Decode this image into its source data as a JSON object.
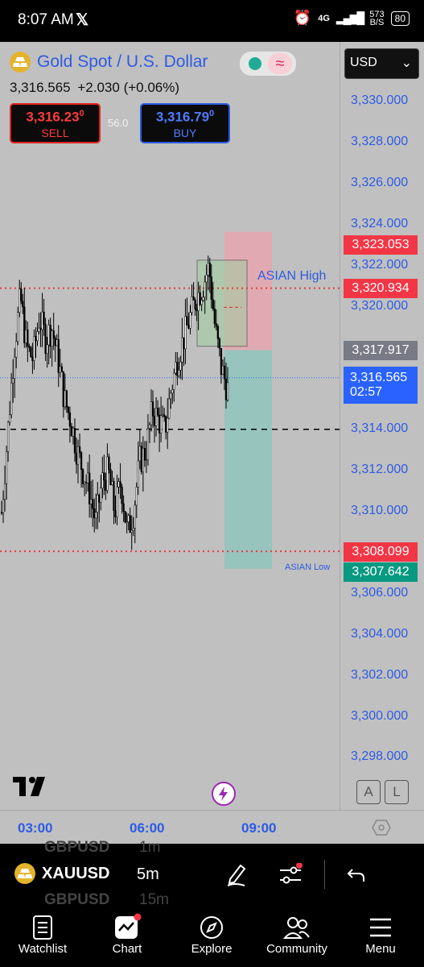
{
  "status_bar": {
    "time": "8:07 AM",
    "network": "4G",
    "speed": "573",
    "speed_unit": "B/S",
    "battery": "80"
  },
  "instrument": {
    "name": "Gold Spot / U.S. Dollar",
    "price": "3,316.565",
    "change": "+2.030 (+0.06%)"
  },
  "sell": {
    "price": "3,316.23",
    "price_sup": "0",
    "label": "SELL"
  },
  "buy": {
    "price": "3,316.79",
    "price_sup": "0",
    "label": "BUY"
  },
  "spread": "56.0",
  "currency": "USD",
  "price_axis": [
    "3,330.000",
    "3,328.000",
    "3,326.000",
    "3,324.000",
    "3,322.000",
    "3,320.000",
    "3,318.000",
    "3,316.000",
    "3,314.000",
    "3,312.000",
    "3,310.000",
    "3,308.000",
    "3,306.000",
    "3,304.000",
    "3,302.000",
    "3,300.000",
    "3,298.000"
  ],
  "price_tags": {
    "stop_loss": "3,323.053",
    "asian_high": "3,320.934",
    "entry": "3,317.917",
    "current": "3,316.565",
    "countdown": "02:57",
    "asian_low": "3,308.099",
    "take_profit": "3,307.642"
  },
  "annotations": {
    "asian_high": "ASIAN High",
    "asian_low": "ASIAN Low"
  },
  "time_axis": [
    "03:00",
    "06:00",
    "09:00"
  ],
  "scale_buttons": {
    "auto": "A",
    "log": "L"
  },
  "toolbar": {
    "symbol": "XAUUSD",
    "interval": "5m",
    "ghost_symbol_1": "GBPUSD",
    "ghost_interval_1": "1m",
    "ghost_symbol_2": "GBPUSD",
    "ghost_interval_2": "15m"
  },
  "nav": [
    {
      "label": "Watchlist",
      "icon": "watchlist-icon"
    },
    {
      "label": "Chart",
      "icon": "chart-icon"
    },
    {
      "label": "Explore",
      "icon": "compass-icon"
    },
    {
      "label": "Community",
      "icon": "community-icon"
    },
    {
      "label": "Menu",
      "icon": "menu-icon"
    }
  ],
  "colors": {
    "accent_blue": "#2d5be3",
    "sell_red": "#e02424",
    "tp_green": "#1f9e7d",
    "sl_pink": "#e8a4ae",
    "tp_fill": "#8fc4bb"
  },
  "chart_data": {
    "type": "candlestick",
    "symbol": "XAUUSD",
    "interval": "5m",
    "ylim": [
      3297,
      3331
    ],
    "trade": {
      "direction": "short",
      "entry": 3317.917,
      "stop_loss": 3323.053,
      "take_profit": 3307.642
    },
    "levels": [
      {
        "label": "ASIAN High",
        "value": 3320.934
      },
      {
        "label": "ASIAN Low",
        "value": 3308.099
      }
    ],
    "last_price": 3316.565,
    "close_path": [
      3310,
      3314,
      3318,
      3320.5,
      3318,
      3317.5,
      3319.5,
      3318.5,
      3319,
      3317.5,
      3315.5,
      3314.5,
      3313,
      3312,
      3311,
      3309.5,
      3311.5,
      3312,
      3310,
      3311.5,
      3309,
      3310,
      3312.5,
      3313,
      3315,
      3314.5,
      3314,
      3316,
      3317.5,
      3318.5,
      3319.5,
      3320.5,
      3321,
      3322,
      3319,
      3317,
      3316
    ]
  }
}
